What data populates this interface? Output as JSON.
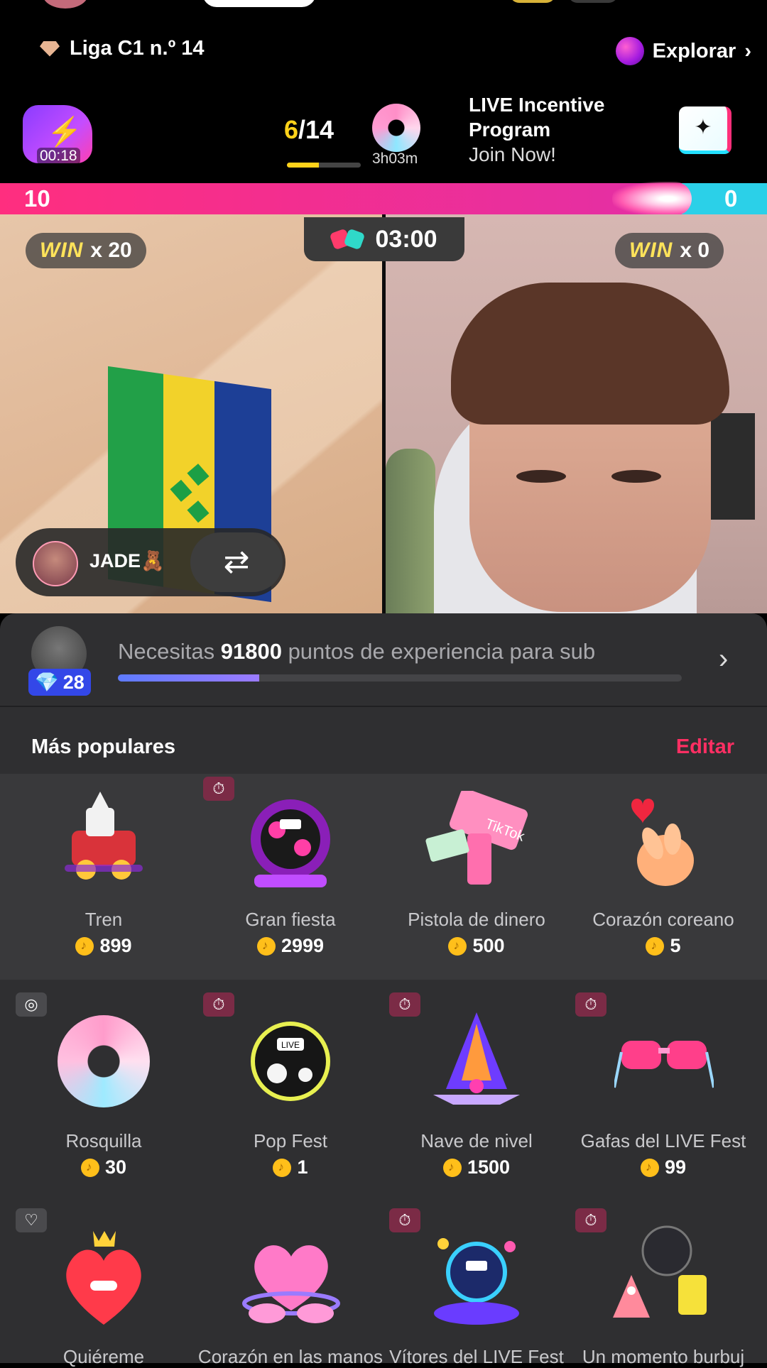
{
  "header": {
    "league": "Liga C1 n.º 14",
    "explore": "Explorar",
    "bolt_timer": "00:18",
    "counter_current": "6",
    "counter_total": "/14",
    "counter_progress": 0.43,
    "donut_timer": "3h03m",
    "incentive_title_1": "LIVE Incentive",
    "incentive_title_2": "Program",
    "incentive_sub": "Join Now!"
  },
  "battle": {
    "score_left": "10",
    "score_right": "0",
    "timer": "03:00",
    "win_label": "WIN",
    "win_left": "x 20",
    "win_right": "x 0",
    "host_name": "JADE🧸",
    "swap_icon": "⇄"
  },
  "xp": {
    "level": "28",
    "text_pre": "Necesitas ",
    "points": "91800",
    "text_post": " puntos de experiencia para sub",
    "progress": 0.25
  },
  "gifts": {
    "section_title": "Más populares",
    "edit_label": "Editar",
    "items": [
      {
        "name": "Tren",
        "price": "899"
      },
      {
        "name": "Gran fiesta",
        "price": "2999"
      },
      {
        "name": "Pistola de dinero",
        "price": "500"
      },
      {
        "name": "Corazón coreano",
        "price": "5"
      },
      {
        "name": "Rosquilla",
        "price": "30"
      },
      {
        "name": "Pop Fest",
        "price": "1"
      },
      {
        "name": "Nave de nivel",
        "price": "1500"
      },
      {
        "name": "Gafas del LIVE Fest",
        "price": "99"
      },
      {
        "name": "Quiéreme",
        "price": ""
      },
      {
        "name": "Corazón en las manos",
        "price": ""
      },
      {
        "name": "Vítores del LIVE Fest",
        "price": ""
      },
      {
        "name": "Un momento burbuj",
        "price": ""
      }
    ]
  }
}
